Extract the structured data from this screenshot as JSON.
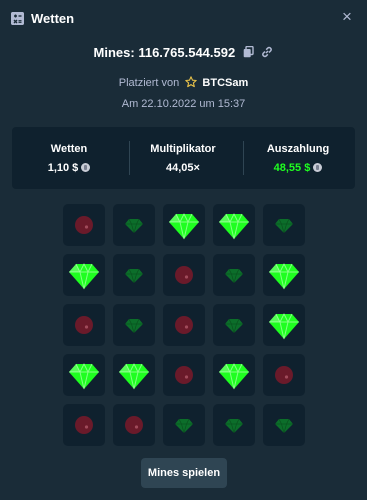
{
  "header": {
    "title": "Wetten",
    "close_symbol": "×"
  },
  "bet": {
    "mines_label": "Mines:",
    "bet_id": "116.765.544.592",
    "placed_by_prefix": "Platziert von",
    "username": "BTCSam",
    "date_text": "Am 22.10.2022 um 15:37"
  },
  "stats": {
    "wager_label": "Wetten",
    "wager_value": "1,10 $",
    "multiplier_label": "Multiplikator",
    "multiplier_value": "44,05×",
    "payout_label": "Auszahlung",
    "payout_value": "48,55 $"
  },
  "colors": {
    "background": "#1a2c38",
    "panel": "#0f212e",
    "tile": "#0f212e",
    "gem_revealed": "#1fff20",
    "gem_dim": "#0c6e2a",
    "mine_dim": "#6a1a2a",
    "payout": "#1fff20",
    "button": "#2f4553"
  },
  "board": [
    [
      "mine",
      "gem",
      "gem-revealed",
      "gem-revealed",
      "gem"
    ],
    [
      "gem-revealed",
      "gem",
      "mine",
      "gem",
      "gem-revealed"
    ],
    [
      "mine",
      "gem",
      "mine",
      "gem",
      "gem-revealed"
    ],
    [
      "gem-revealed",
      "gem-revealed",
      "mine",
      "gem-revealed",
      "mine"
    ],
    [
      "mine",
      "mine",
      "gem",
      "gem",
      "gem"
    ]
  ],
  "play_button": {
    "label": "Mines spielen"
  }
}
